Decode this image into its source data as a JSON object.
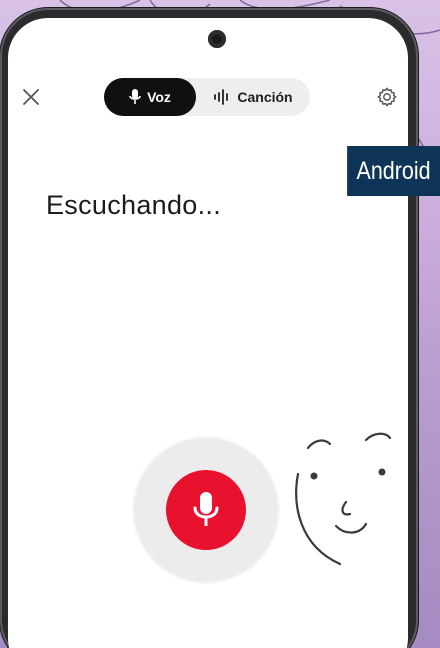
{
  "header": {
    "close_icon": "close-icon",
    "settings_icon": "gear-icon"
  },
  "mode_switch": {
    "voice_label": "Voz",
    "song_label": "Canción",
    "voice_icon": "mic-icon",
    "song_icon": "sound-wave-icon",
    "selected": "Voz"
  },
  "main": {
    "status_text": "Escuchando..."
  },
  "mic": {
    "icon": "mic-icon",
    "color": "#e8112e"
  },
  "badge": {
    "label": "Android",
    "color": "#0e3557"
  }
}
